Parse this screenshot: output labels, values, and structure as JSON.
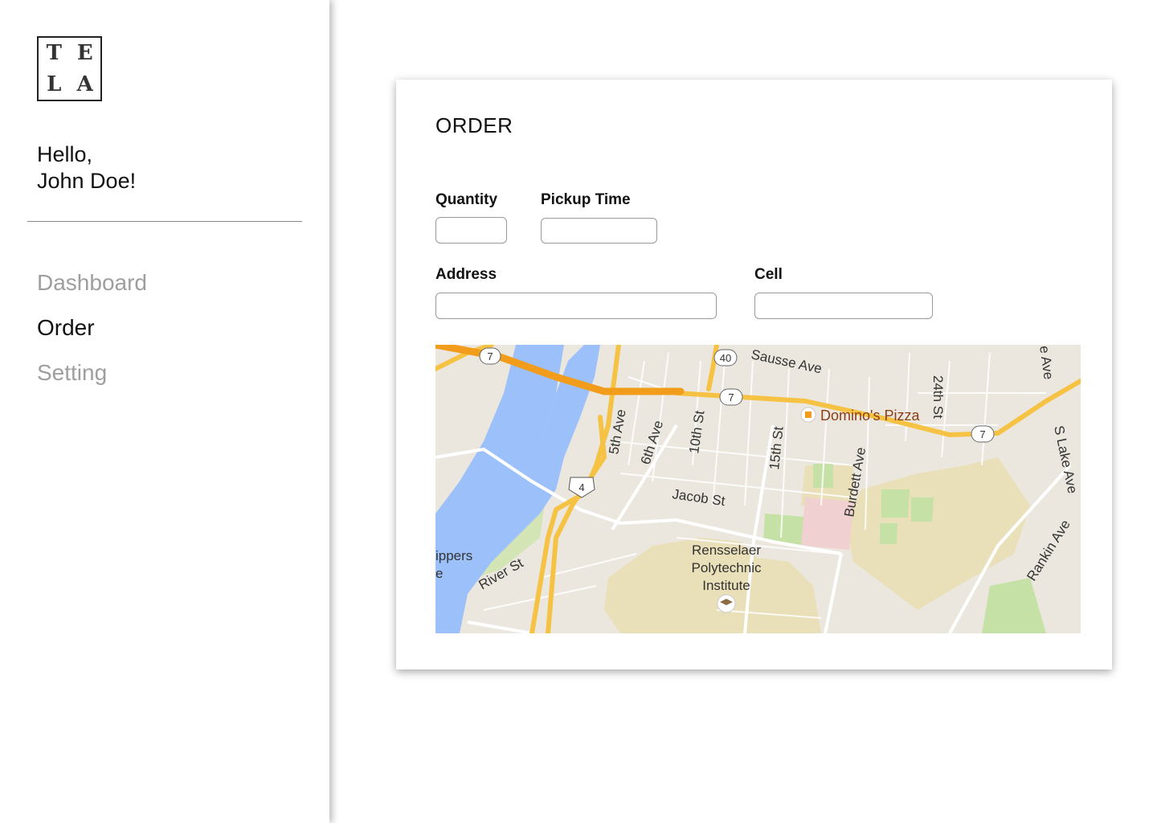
{
  "logo": {
    "letters": [
      "T",
      "E",
      "L",
      "A"
    ]
  },
  "sidebar": {
    "greeting_line1": "Hello,",
    "greeting_line2": "John Doe!",
    "nav": [
      {
        "label": "Dashboard",
        "active": false
      },
      {
        "label": "Order",
        "active": true
      },
      {
        "label": "Setting",
        "active": false
      }
    ]
  },
  "order": {
    "title": "ORDER",
    "fields": {
      "quantity": {
        "label": "Quantity",
        "value": ""
      },
      "pickup_time": {
        "label": "Pickup Time",
        "value": ""
      },
      "address": {
        "label": "Address",
        "value": ""
      },
      "cell": {
        "label": "Cell",
        "value": ""
      }
    }
  },
  "map": {
    "street_labels": [
      "Sausse Ave",
      "24th St",
      "e Ave",
      "S Lake Ave",
      "5th Ave",
      "6th Ave",
      "10th St",
      "15th St",
      "Burdett Ave",
      "Jacob St",
      "River St",
      "Rankin Ave",
      "ippers",
      "e"
    ],
    "route_shields": [
      "7",
      "40",
      "7",
      "7",
      "4"
    ],
    "poi": {
      "domino": "Domino's Pizza",
      "rpi_line1": "Rensselaer",
      "rpi_line2": "Polytechnic",
      "rpi_line3": "Institute"
    },
    "colors": {
      "water": "#9cc0f9",
      "highway": "#f6c244",
      "major_highway": "#f29c1c",
      "land": "#ebe7df",
      "campus": "#e9dfb8",
      "park": "#c5e1a5"
    }
  }
}
